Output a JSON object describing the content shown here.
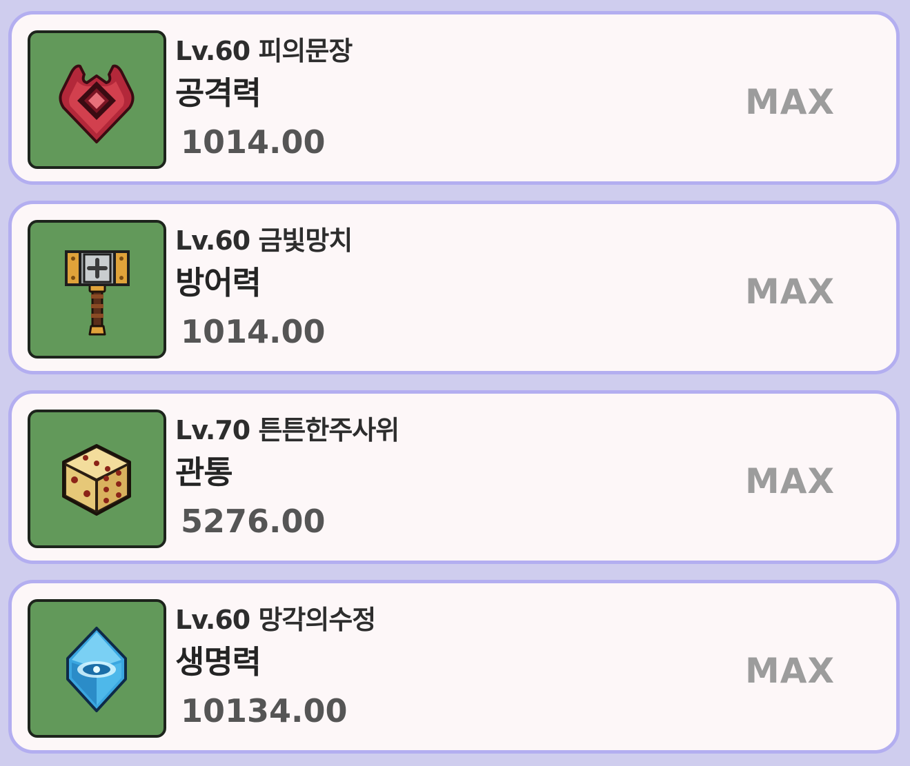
{
  "items": [
    {
      "level": "Lv.60",
      "name": "피의문장",
      "stat": "공격력",
      "value": "1014.00",
      "status": "MAX",
      "icon": "blood-crest-icon"
    },
    {
      "level": "Lv.60",
      "name": "금빛망치",
      "stat": "방어력",
      "value": "1014.00",
      "status": "MAX",
      "icon": "golden-hammer-icon"
    },
    {
      "level": "Lv.70",
      "name": "튼튼한주사위",
      "stat": "관통",
      "value": "5276.00",
      "status": "MAX",
      "icon": "sturdy-dice-icon"
    },
    {
      "level": "Lv.60",
      "name": "망각의수정",
      "stat": "생명력",
      "value": "10134.00",
      "status": "MAX",
      "icon": "crystal-of-oblivion-icon"
    }
  ],
  "colors": {
    "background": "#cfcdee",
    "card": "#fdf7f8",
    "card_border": "#b3aef0",
    "icon_bg": "#62995a",
    "max_text": "#9c9c9c"
  }
}
